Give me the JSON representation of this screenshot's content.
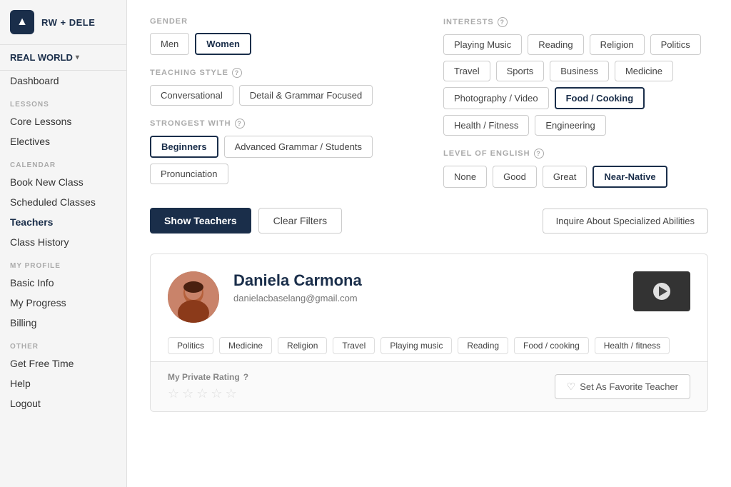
{
  "sidebar": {
    "logo_icon": "▲",
    "logo_text": "RW + DELE",
    "org_label": "REAL WORLD",
    "nav_items": [
      {
        "id": "dashboard",
        "label": "Dashboard",
        "section": null,
        "active": false
      },
      {
        "id": "core-lessons",
        "label": "Core Lessons",
        "section": "LESSONS",
        "active": false
      },
      {
        "id": "electives",
        "label": "Electives",
        "section": null,
        "active": false
      },
      {
        "id": "book-new-class",
        "label": "Book New Class",
        "section": "CALENDAR",
        "active": false
      },
      {
        "id": "scheduled-classes",
        "label": "Scheduled Classes",
        "section": null,
        "active": false
      },
      {
        "id": "teachers",
        "label": "Teachers",
        "section": null,
        "active": true
      },
      {
        "id": "class-history",
        "label": "Class History",
        "section": null,
        "active": false
      },
      {
        "id": "basic-info",
        "label": "Basic Info",
        "section": "MY PROFILE",
        "active": false
      },
      {
        "id": "my-progress",
        "label": "My Progress",
        "section": null,
        "active": false
      },
      {
        "id": "billing",
        "label": "Billing",
        "section": null,
        "active": false
      },
      {
        "id": "get-free-time",
        "label": "Get Free Time",
        "section": "OTHER",
        "active": false
      },
      {
        "id": "help",
        "label": "Help",
        "section": null,
        "active": false
      },
      {
        "id": "logout",
        "label": "Logout",
        "section": null,
        "active": false
      }
    ]
  },
  "filters": {
    "gender": {
      "label": "GENDER",
      "options": [
        "Men",
        "Women"
      ],
      "selected": "Women"
    },
    "teaching_style": {
      "label": "TEACHING STYLE",
      "options": [
        "Conversational",
        "Detail & Grammar Focused"
      ],
      "selected": null
    },
    "strongest_with": {
      "label": "STRONGEST WITH",
      "options": [
        "Beginners",
        "Advanced Grammar / Students",
        "Pronunciation"
      ],
      "selected": "Beginners"
    },
    "interests": {
      "label": "INTERESTS",
      "options": [
        "Playing Music",
        "Reading",
        "Religion",
        "Politics",
        "Travel",
        "Sports",
        "Business",
        "Medicine",
        "Photography / Video",
        "Food / Cooking",
        "Health / Fitness",
        "Engineering"
      ],
      "selected": "Food / Cooking"
    },
    "level_of_english": {
      "label": "LEVEL OF ENGLISH",
      "options": [
        "None",
        "Good",
        "Great",
        "Near-Native"
      ],
      "selected": "Near-Native"
    }
  },
  "actions": {
    "show_teachers": "Show Teachers",
    "clear_filters": "Clear Filters",
    "inquire_specialized": "Inquire About Specialized Abilities"
  },
  "teacher": {
    "name": "Daniela Carmona",
    "email": "danielacbaselang@gmail.com",
    "tags": [
      "Politics",
      "Medicine",
      "Religion",
      "Travel",
      "Playing music",
      "Reading",
      "Food / cooking",
      "Health / fitness"
    ],
    "rating_label": "My Private Rating",
    "stars": [
      false,
      false,
      false,
      false,
      false
    ],
    "fav_label": "Set As Favorite Teacher"
  }
}
